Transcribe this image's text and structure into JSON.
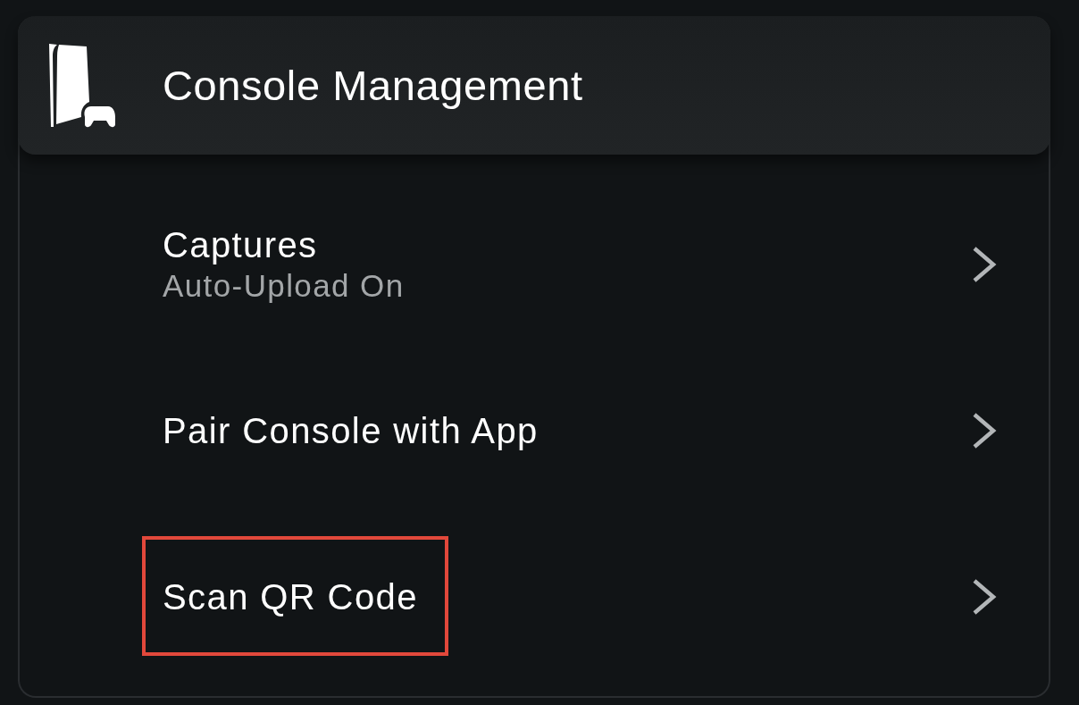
{
  "header": {
    "title": "Console Management"
  },
  "rows": [
    {
      "title": "Captures",
      "subtitle": "Auto-Upload On",
      "highlighted": false
    },
    {
      "title": "Pair Console with App",
      "highlighted": false
    },
    {
      "title": "Scan QR Code",
      "highlighted": true
    }
  ]
}
